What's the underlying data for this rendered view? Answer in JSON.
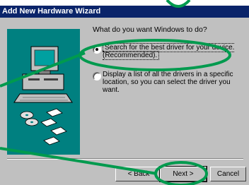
{
  "window": {
    "title": "Add New Hardware Wizard"
  },
  "wizard": {
    "question": "What do you want Windows to do?",
    "options": [
      {
        "line1": "Search for the best driver for your device.",
        "line2": "(Recommended).",
        "selected": true
      },
      {
        "line1": "Display a list of all the drivers in a specific",
        "line2": "location, so you can select the driver you want.",
        "selected": false
      }
    ]
  },
  "buttons": {
    "back": "< Back",
    "next": "Next >",
    "cancel": "Cancel"
  },
  "colors": {
    "titlebar": "#0a246a",
    "dialog": "#c0c0c0",
    "illustration_bg": "#008080",
    "annotation_green": "#009a4e"
  }
}
